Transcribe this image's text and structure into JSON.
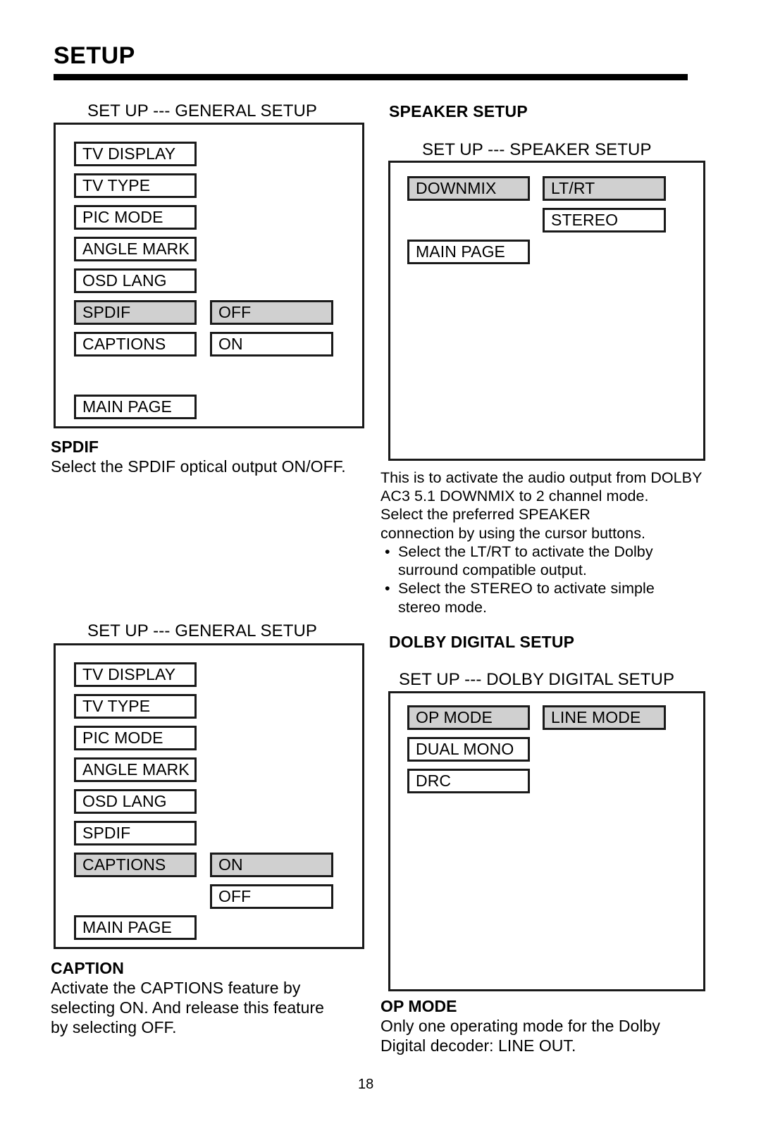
{
  "page": {
    "title": "SETUP",
    "number": "18"
  },
  "general_setup_spdif": {
    "caption": "SET UP --- GENERAL SETUP",
    "menu_items": [
      {
        "label": "TV DISPLAY",
        "selected": false
      },
      {
        "label": "TV TYPE",
        "selected": false
      },
      {
        "label": "PIC MODE",
        "selected": false
      },
      {
        "label": "ANGLE MARK",
        "selected": false
      },
      {
        "label": "OSD LANG",
        "selected": false
      },
      {
        "label": "SPDIF",
        "selected": true
      },
      {
        "label": "CAPTIONS",
        "selected": false
      }
    ],
    "main_page": "MAIN PAGE",
    "values": [
      {
        "label": "OFF",
        "selected": true
      },
      {
        "label": "ON",
        "selected": false
      }
    ]
  },
  "spdif_desc": {
    "heading": "SPDIF",
    "lines": [
      "Select the SPDIF optical output ON/OFF."
    ]
  },
  "general_setup_captions": {
    "caption": "SET UP --- GENERAL SETUP",
    "menu_items": [
      {
        "label": "TV DISPLAY",
        "selected": false
      },
      {
        "label": "TV TYPE",
        "selected": false
      },
      {
        "label": "PIC MODE",
        "selected": false
      },
      {
        "label": "ANGLE MARK",
        "selected": false
      },
      {
        "label": "OSD LANG",
        "selected": false
      },
      {
        "label": "SPDIF",
        "selected": false
      },
      {
        "label": "CAPTIONS",
        "selected": true
      }
    ],
    "main_page": "MAIN PAGE",
    "values": [
      {
        "label": "ON",
        "selected": true
      },
      {
        "label": "OFF",
        "selected": false
      }
    ]
  },
  "caption_desc": {
    "heading": "CAPTION",
    "lines": [
      "Activate the CAPTIONS feature by",
      "selecting ON.  And release this feature",
      "by selecting OFF."
    ]
  },
  "speaker_setup": {
    "heading": "SPEAKER SETUP",
    "caption": "SET UP --- SPEAKER SETUP",
    "menu_items": [
      {
        "label": "DOWNMIX",
        "selected": true
      }
    ],
    "main_page": "MAIN PAGE",
    "values": [
      {
        "label": "LT/RT",
        "selected": true
      },
      {
        "label": "STEREO",
        "selected": false
      }
    ]
  },
  "speaker_desc": {
    "lines": [
      "This is to activate the audio output from DOLBY",
      "AC3 5.1 DOWNMIX to 2 channel mode.",
      "Select the preferred SPEAKER",
      "connection by using the cursor buttons."
    ],
    "bullets": [
      {
        "first": "Select the LT/RT to activate the Dolby",
        "cont": "surround compatible output."
      },
      {
        "first": "Select the STEREO to activate simple",
        "cont": "stereo mode."
      }
    ],
    "bullet_glyph": "•"
  },
  "dolby_digital_setup": {
    "heading": "DOLBY DIGITAL SETUP",
    "caption": "SET UP --- DOLBY DIGITAL SETUP",
    "menu_items": [
      {
        "label": "OP MODE",
        "selected": true
      },
      {
        "label": "DUAL MONO",
        "selected": false
      },
      {
        "label": "DRC",
        "selected": false
      }
    ],
    "values": [
      {
        "label": "LINE MODE",
        "selected": true
      }
    ]
  },
  "op_mode_desc": {
    "heading": "OP MODE",
    "lines": [
      "Only one operating mode for the Dolby",
      "Digital decoder:  LINE OUT."
    ]
  }
}
